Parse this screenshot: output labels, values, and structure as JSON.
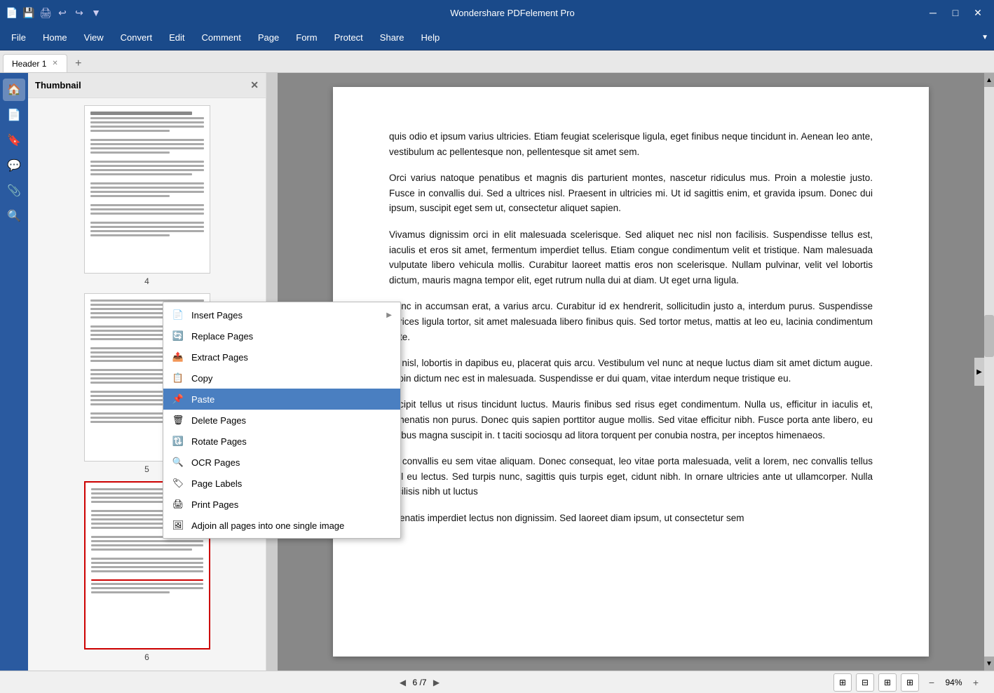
{
  "app": {
    "title": "Wondershare PDFelement Pro"
  },
  "titlebar": {
    "icons": [
      "🖫",
      "💾",
      "🖨",
      "↩",
      "↪",
      "▼"
    ],
    "controls": [
      "─",
      "□",
      "✕"
    ]
  },
  "menubar": {
    "items": [
      "File",
      "Home",
      "View",
      "Convert",
      "Edit",
      "Comment",
      "Page",
      "Form",
      "Protect",
      "Share",
      "Help"
    ]
  },
  "tabs": [
    {
      "label": "Header 1",
      "active": true
    }
  ],
  "thumbnail": {
    "title": "Thumbnail",
    "pages": [
      {
        "num": "4",
        "selected": false
      },
      {
        "num": "5",
        "selected": false
      },
      {
        "num": "6",
        "selected": true
      }
    ]
  },
  "pdf": {
    "paragraphs": [
      "quis odio et ipsum varius ultricies. Etiam feugiat scelerisque ligula, eget finibus neque tincidunt in. Aenean leo ante, vestibulum ac pellentesque non, pellentesque sit amet sem.",
      "Orci varius natoque penatibus et magnis dis parturient montes, nascetur ridiculus mus. Proin a molestie justo. Fusce in convallis dui. Sed a ultrices nisl. Praesent in ultricies mi. Ut id sagittis enim, et gravida ipsum. Donec dui ipsum, suscipit eget sem ut, consectetur aliquet sapien.",
      "Vivamus dignissim orci in elit malesuada scelerisque. Sed aliquet nec nisl non facilisis. Suspendisse tellus est, iaculis et eros sit amet, fermentum imperdiet tellus. Etiam congue condimentum velit et tristique. Nam malesuada vulputate libero vehicula mollis. Curabitur laoreet mattis eros non scelerisque. Nullam pulvinar, velit vel lobortis dictum, mauris magna tempor elit, eget rutrum nulla dui at diam. Ut eget urna ligula.",
      "Nunc in accumsan erat, a varius arcu. Curabitur id ex hendrerit, sollicitudin justo a, interdum purus. Suspendisse ultrices ligula tortor, sit amet malesuada libero finibus quis. Sed tortor metus, mattis at leo eu, lacinia condimentum ante.",
      "ex nisl, lobortis in dapibus eu, placerat quis arcu. Vestibulum vel nunc at neque luctus diam sit amet dictum augue. Proin dictum nec est in malesuada. Suspendisse er dui quam, vitae interdum neque tristique eu.",
      "uscipit tellus ut risus tincidunt luctus. Mauris finibus sed risus eget condimentum. Nulla us, efficitur in iaculis et, venenatis non purus. Donec quis sapien porttitor augue mollis. Sed vitae efficitur nibh. Fusce porta ante libero, eu finibus magna suscipit in. t taciti sociosqu ad litora torquent per conubia nostra, per inceptos himenaeos.",
      "se convallis eu sem vitae aliquam. Donec consequat, leo vitae porta malesuada, velit a lorem, nec convallis tellus nisl eu lectus. Sed turpis nunc, sagittis quis turpis eget, cidunt nibh. In ornare ultricies ante ut ullamcorper. Nulla facilisis nibh ut luctus",
      "enenatis imperdiet lectus non dignissim. Sed laoreet diam ipsum, ut consectetur sem"
    ]
  },
  "context_menu": {
    "items": [
      {
        "id": "insert-pages",
        "label": "Insert Pages",
        "icon": "📄",
        "has_arrow": true
      },
      {
        "id": "replace-pages",
        "label": "Replace Pages",
        "icon": "🔄",
        "has_arrow": false
      },
      {
        "id": "extract-pages",
        "label": "Extract Pages",
        "icon": "📤",
        "has_arrow": false
      },
      {
        "id": "copy",
        "label": "Copy",
        "icon": "📋",
        "has_arrow": false
      },
      {
        "id": "paste",
        "label": "Paste",
        "icon": "📌",
        "has_arrow": false,
        "highlighted": true
      },
      {
        "id": "delete-pages",
        "label": "Delete Pages",
        "icon": "🗑",
        "has_arrow": false
      },
      {
        "id": "rotate-pages",
        "label": "Rotate Pages",
        "icon": "🔃",
        "has_arrow": false
      },
      {
        "id": "ocr-pages",
        "label": "OCR Pages",
        "icon": "🔍",
        "has_arrow": false
      },
      {
        "id": "page-labels",
        "label": "Page Labels",
        "icon": "🏷",
        "has_arrow": false
      },
      {
        "id": "print-pages",
        "label": "Print Pages",
        "icon": "🖨",
        "has_arrow": false
      },
      {
        "id": "adjoin",
        "label": "Adjoin all pages into one single image",
        "icon": "🖼",
        "has_arrow": false
      }
    ]
  },
  "statusbar": {
    "prev_label": "◀",
    "next_label": "▶",
    "page_info": "6 /7",
    "zoom_level": "94%",
    "zoom_out": "−",
    "zoom_in": "+"
  }
}
